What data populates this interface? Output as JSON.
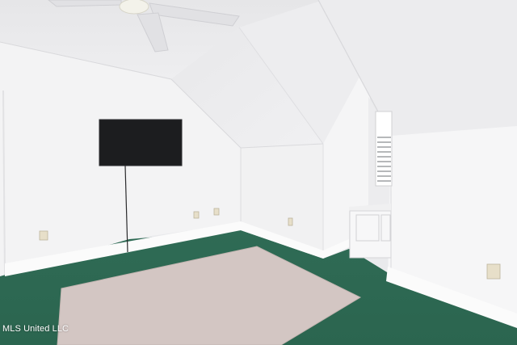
{
  "photo": {
    "watermark": "MLS United LLC",
    "colors": {
      "wall": "#f3f3f4",
      "ceiling": "#ebebed",
      "carpet": "#2f6b54",
      "rug": "#d3c6c3",
      "tv": "#1c1d1f",
      "baseboard": "#fbfbfb"
    }
  }
}
